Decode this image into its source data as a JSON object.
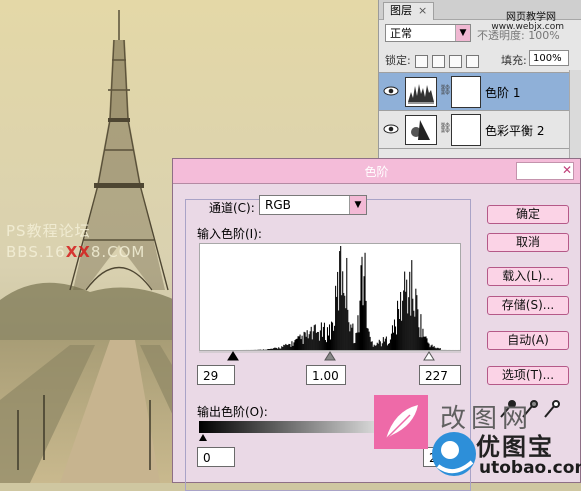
{
  "photo": {
    "watermark_line1": "PS教程论坛",
    "watermark_line2_a": "BBS.16",
    "watermark_line2_b": "XX",
    "watermark_line2_c": "8.COM"
  },
  "layers_panel": {
    "tab_label": "图层",
    "tab_close": "×",
    "site_name": "网页教学网",
    "site_url": "www.webjx.com",
    "blend_mode": "正常",
    "opacity_label": "不透明度: 100%",
    "lock_label": "锁定:",
    "fill_label": "填充:",
    "fill_value": "100%",
    "layers": [
      {
        "name": "色阶 1",
        "selected": true,
        "thumb": "levels-icon"
      },
      {
        "name": "色彩平衡 2",
        "selected": false,
        "thumb": "color-balance-icon"
      }
    ]
  },
  "levels_dialog": {
    "title": "色阶",
    "channel_label": "通道(C):",
    "channel_value": "RGB",
    "input_levels_label": "输入色阶(I):",
    "input_black": "29",
    "input_gamma": "1.00",
    "input_white": "227",
    "output_levels_label": "输出色阶(O):",
    "output_black": "0",
    "output_white": "255",
    "buttons": [
      "确定",
      "取消",
      "载入(L)...",
      "存储(S)...",
      "自动(A)",
      "选项(T)..."
    ]
  },
  "logo": {
    "text_cn": "改图网",
    "text_cn2": "优图宝",
    "url": "utobao.com"
  },
  "colors": {
    "dialog_bg": "#ead9e6",
    "dialog_title": "#f4bcd9",
    "button_bg": "#fbd3e6",
    "selected_layer": "#8fb0d8",
    "logo_pink": "#ee6aa8"
  }
}
